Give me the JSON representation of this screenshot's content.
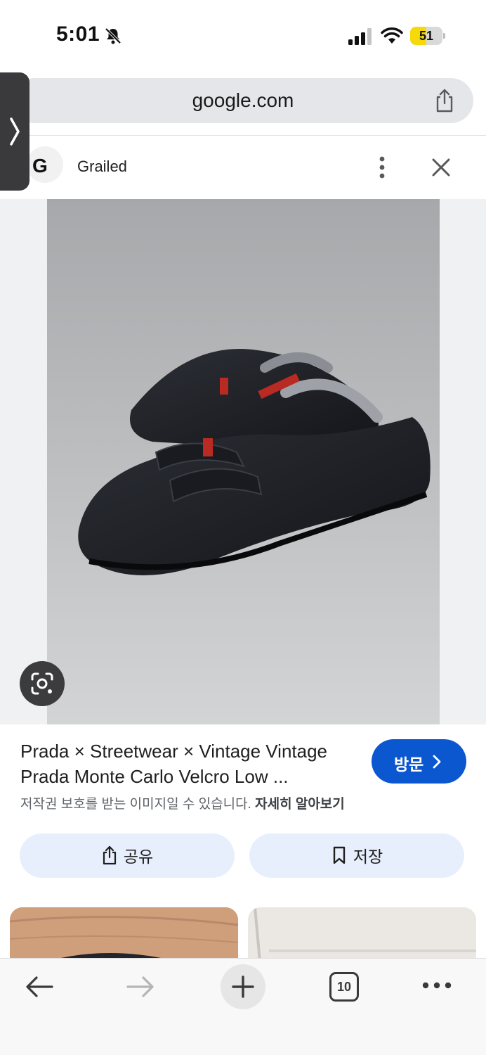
{
  "status_bar": {
    "time": "5:01",
    "battery_level": "51"
  },
  "browser": {
    "url": "google.com"
  },
  "source": {
    "logo_letter": "G",
    "name": "Grailed"
  },
  "result": {
    "title": "Prada × Streetwear × Vintage Vintage Prada Monte Carlo Velcro Low ...",
    "visit_label": "방문",
    "copyright_notice": "저작권 보호를 받는 이미지일 수 있습니다.",
    "learn_more": "자세히 알아보기"
  },
  "actions": {
    "share_label": "공유",
    "save_label": "저장"
  },
  "toolbar": {
    "tab_count": "10"
  },
  "colors": {
    "accent": "#0b57d0",
    "action_button_bg": "#e8effc",
    "battery": "#f5d90a"
  },
  "icons": [
    "bell-slash-icon",
    "signal-icon",
    "wifi-icon",
    "battery-icon",
    "share-icon",
    "chevron-right-icon",
    "more-vert-icon",
    "close-icon",
    "lens-icon",
    "bookmark-icon",
    "back-arrow-icon",
    "forward-arrow-icon",
    "plus-icon",
    "tabs-icon",
    "more-horiz-icon"
  ]
}
